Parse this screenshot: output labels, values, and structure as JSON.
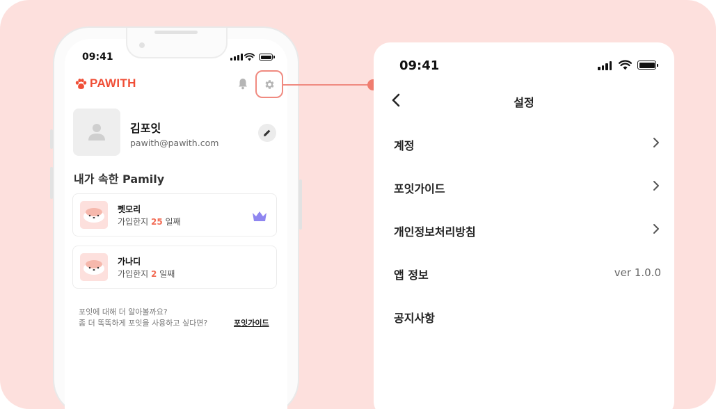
{
  "left_phone": {
    "status_time": "09:41",
    "brand": "PAWITH",
    "profile": {
      "name": "김포잇",
      "email": "pawith@pawith.com"
    },
    "section_title": "내가 속한 Pamily",
    "pamilies": [
      {
        "name": "펫모리",
        "joined_prefix": "가입한지 ",
        "days": "25",
        "joined_suffix": " 일째",
        "owner": true
      },
      {
        "name": "가나디",
        "joined_prefix": "가입한지 ",
        "days": "2",
        "joined_suffix": " 일째",
        "owner": false
      }
    ],
    "help_line1": "포잇에 대해 더 알아볼까요?",
    "help_line2": "좀 더 똑똑하게 포잇을 사용하고 싶다면?",
    "help_link": "포잇가이드"
  },
  "settings_screen": {
    "status_time": "09:41",
    "title": "설정",
    "items": [
      {
        "label": "계정",
        "value": "",
        "chevron": true
      },
      {
        "label": "포잇가이드",
        "value": "",
        "chevron": true
      },
      {
        "label": "개인정보처리방침",
        "value": "",
        "chevron": true
      },
      {
        "label": "앱 정보",
        "value": "ver 1.0.0",
        "chevron": false
      },
      {
        "label": "공지사항",
        "value": "",
        "chevron": false
      }
    ]
  },
  "colors": {
    "background": "#fde0dd",
    "brand": "#f04f37",
    "highlight": "#f08a80",
    "crown": "#8f86f0",
    "day_count": "#f26c55"
  }
}
